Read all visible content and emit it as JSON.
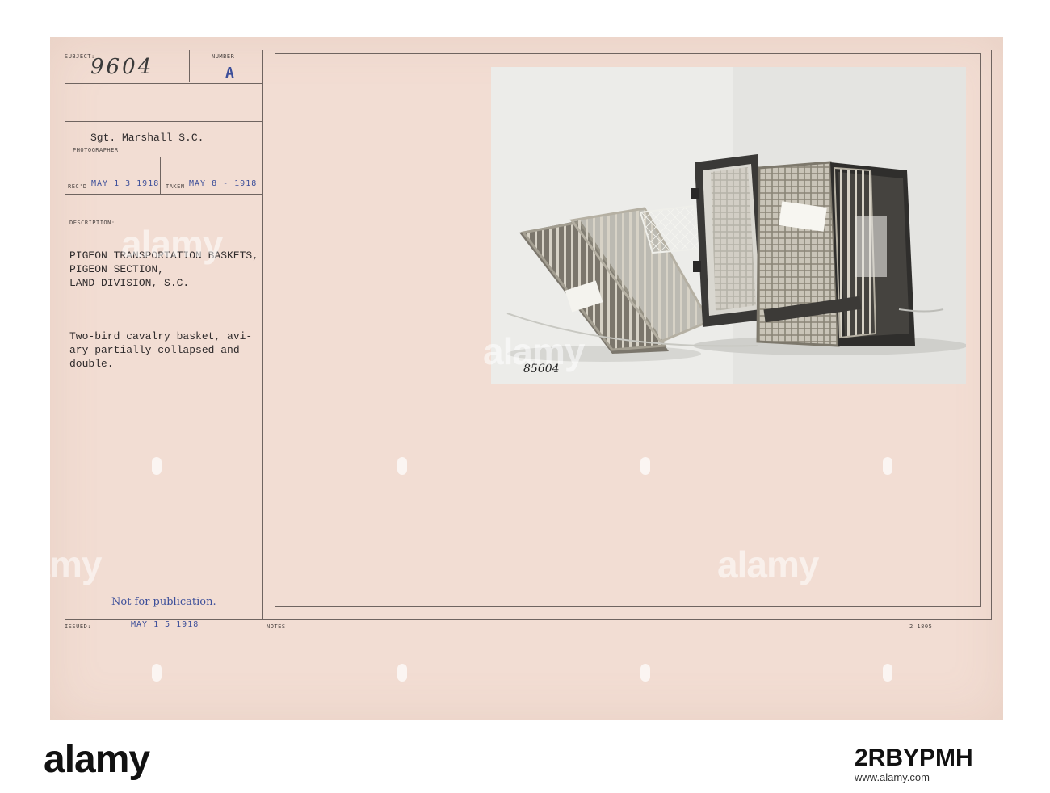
{
  "record": {
    "subject_label": "SUBJECT:",
    "subject_number": "9604",
    "number_label": "NUMBER",
    "number_value": "A",
    "photographer_name": "Sgt. Marshall S.C.",
    "photographer_label": "PHOTOGRAPHER",
    "recd_label": "REC'D",
    "recd_date": "MAY 1 3 1918",
    "taken_label": "TAKEN",
    "taken_date": "MAY 8 - 1918",
    "description_label": "DESCRIPTION:",
    "title_lines": [
      "PIGEON TRANSPORTATION BASKETS,",
      "PIGEON SECTION,",
      "LAND DIVISION, S.C."
    ],
    "caption_lines": [
      "Two-bird cavalry basket, avi-",
      "ary partially collapsed and",
      "double."
    ],
    "publication_note": "Not for publication.",
    "issued_label": "ISSUED:",
    "issued_date": "MAY 1 5 1918",
    "notes_label": "NOTES",
    "form_number": "2—1805"
  },
  "photo": {
    "negative_number": "85604"
  },
  "watermark": {
    "text": "alamy"
  },
  "footer": {
    "logo": "alamy",
    "image_id": "2RBYPMH",
    "site": "www.alamy.com"
  },
  "colors": {
    "card": "#f2ddd3",
    "stamp_ink": "#3d4f9a",
    "typewriter_ink": "#2f2b2c"
  }
}
